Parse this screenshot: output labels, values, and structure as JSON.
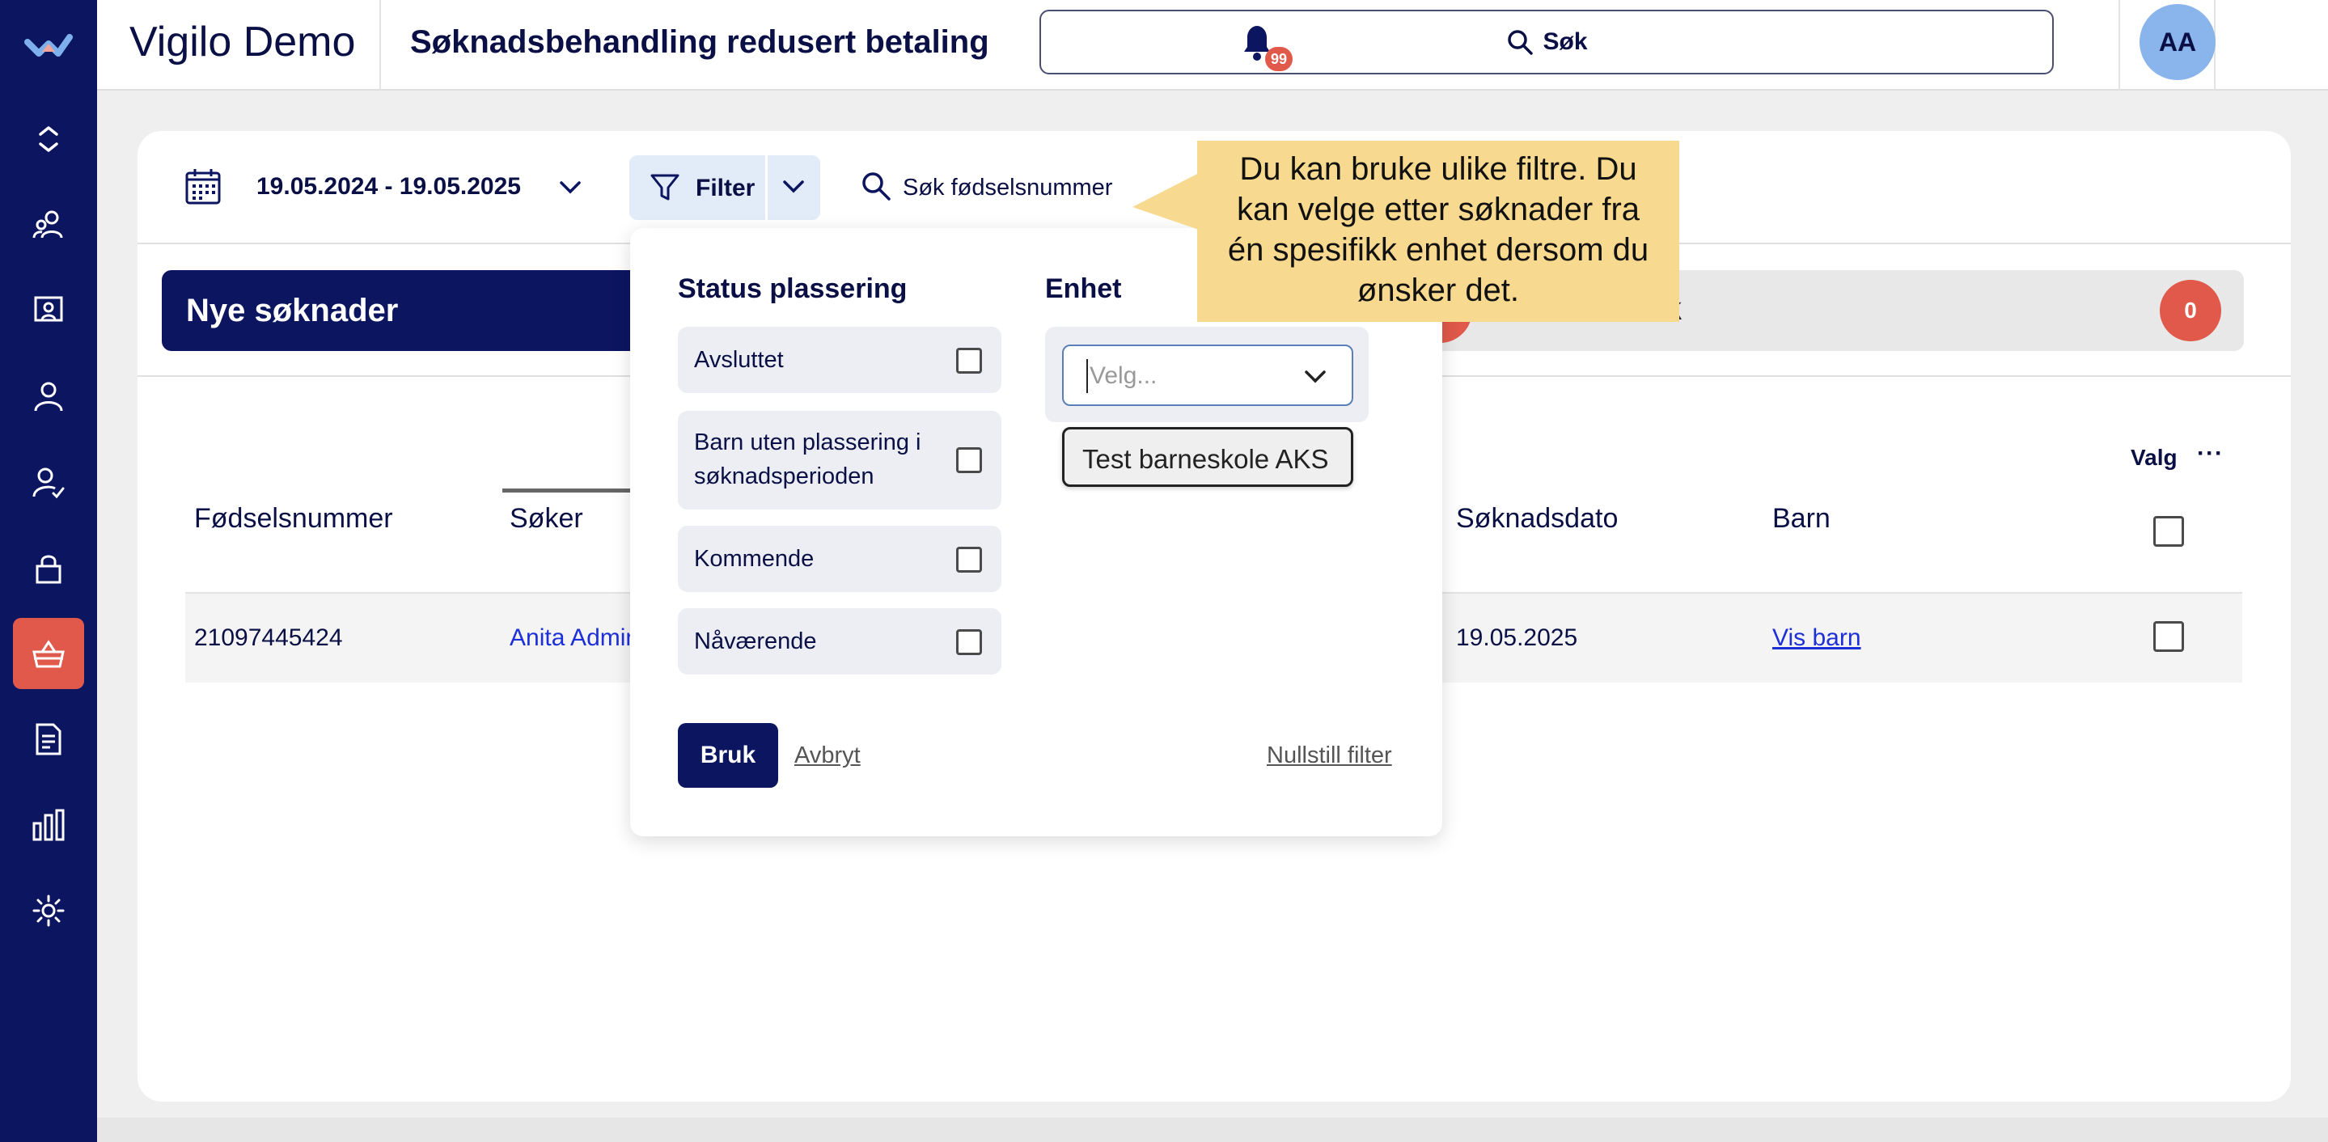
{
  "app": {
    "title": "Vigilo Demo",
    "page_title": "Søknadsbehandling redusert betaling"
  },
  "header": {
    "search_label": "Søk",
    "notification_count": "99",
    "avatar_initials": "AA"
  },
  "colors": {
    "navy": "#0c1560",
    "accent_red": "#e0594a",
    "avatar_bg": "#89b4ec",
    "tooltip_bg": "#f7d98f",
    "link": "#1c2fd8"
  },
  "sidebar": {
    "items": [
      {
        "icon": "expand-collapse-icon"
      },
      {
        "icon": "people-icon"
      },
      {
        "icon": "presentation-icon"
      },
      {
        "icon": "person-icon"
      },
      {
        "icon": "person-check-icon"
      },
      {
        "icon": "lock-icon"
      },
      {
        "icon": "basket-icon",
        "active": true
      },
      {
        "icon": "document-icon"
      },
      {
        "icon": "bar-chart-icon"
      },
      {
        "icon": "gear-icon"
      }
    ]
  },
  "toolbar": {
    "date_range": "19.05.2024 - 19.05.2025",
    "filter_label": "Filter",
    "ssn_search": "Søk fødselsnummer"
  },
  "tabs": {
    "new_label": "Nye søknader",
    "other_label": "Vedtak",
    "other_count": "0"
  },
  "table": {
    "valg_label": "Valg",
    "valg_menu": "···",
    "columns": [
      "Fødselsnummer",
      "Søker",
      "Søknadsdato",
      "Barn"
    ],
    "rows": [
      {
        "ssn": "21097445424",
        "applicant": "Anita Admin",
        "date": "19.05.2025",
        "child_link": "Vis barn"
      }
    ]
  },
  "filter_panel": {
    "status_heading": "Status plassering",
    "status_options": [
      "Avsluttet",
      "Barn uten plassering i\nsøknadsperioden",
      "Kommende",
      "Nåværende"
    ],
    "unit_heading": "Enhet",
    "unit_placeholder": "Velg...",
    "unit_options": [
      "Test barneskole AKS"
    ],
    "apply_label": "Bruk",
    "cancel_label": "Avbryt",
    "reset_label": "Nullstill filter"
  },
  "tooltip": {
    "text": "Du kan bruke ulike filtre. Du\nkan velge etter søknader fra\nén spesifikk enhet  dersom du\nønsker det."
  }
}
